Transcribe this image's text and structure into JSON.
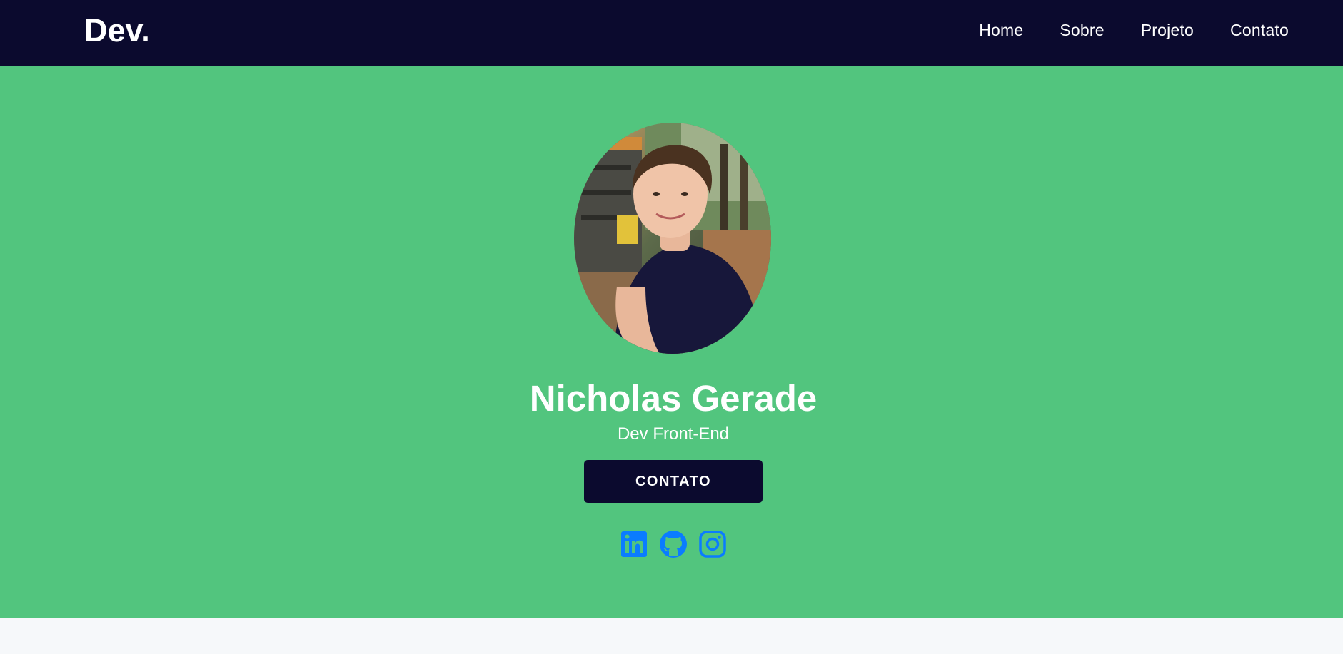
{
  "header": {
    "logo": "Dev.",
    "nav": [
      {
        "label": "Home"
      },
      {
        "label": "Sobre"
      },
      {
        "label": "Projeto"
      },
      {
        "label": "Contato"
      }
    ]
  },
  "hero": {
    "name": "Nicholas Gerade",
    "role": "Dev Front-End",
    "cta_label": "CONTATO",
    "socials": [
      {
        "icon": "linkedin-icon"
      },
      {
        "icon": "github-icon"
      },
      {
        "icon": "instagram-icon"
      }
    ]
  },
  "colors": {
    "navbar": "#0b0a2e",
    "hero_bg": "#52c57e",
    "button": "#0b0a2e",
    "social_icons": "#0a7cff",
    "page_bg": "#f6f8fa"
  }
}
